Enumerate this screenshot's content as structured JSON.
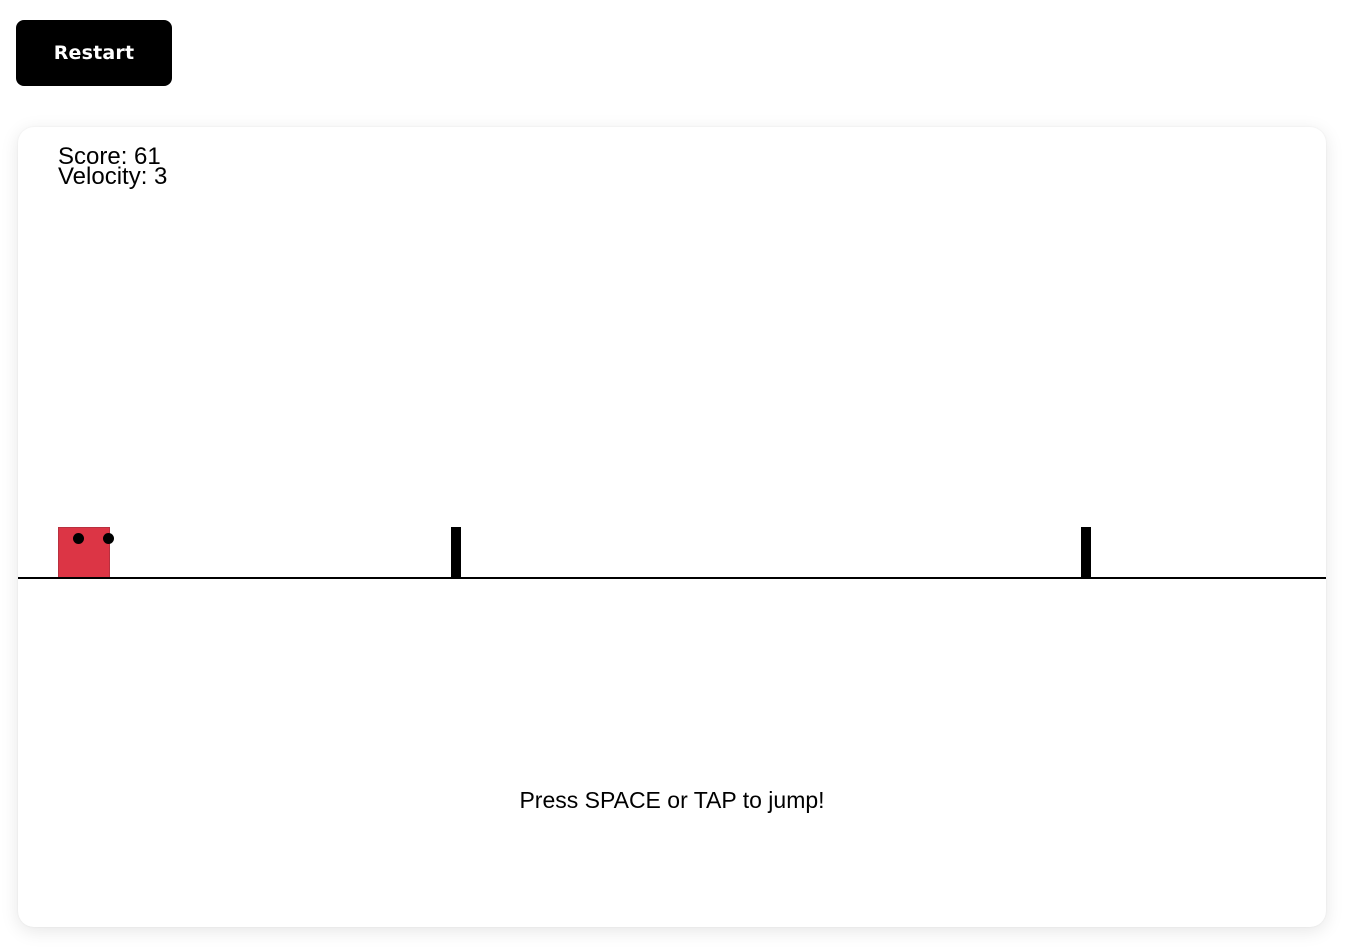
{
  "controls": {
    "restart_label": "Restart"
  },
  "hud": {
    "score_text": "Score: 61",
    "velocity_text": "Velocity: 3"
  },
  "game": {
    "instructions": "Press SPACE or TAP to jump!",
    "player_color": "#dc3545",
    "obstacle_color": "#000000",
    "ground_color": "#000000",
    "obstacle_count": 2
  }
}
